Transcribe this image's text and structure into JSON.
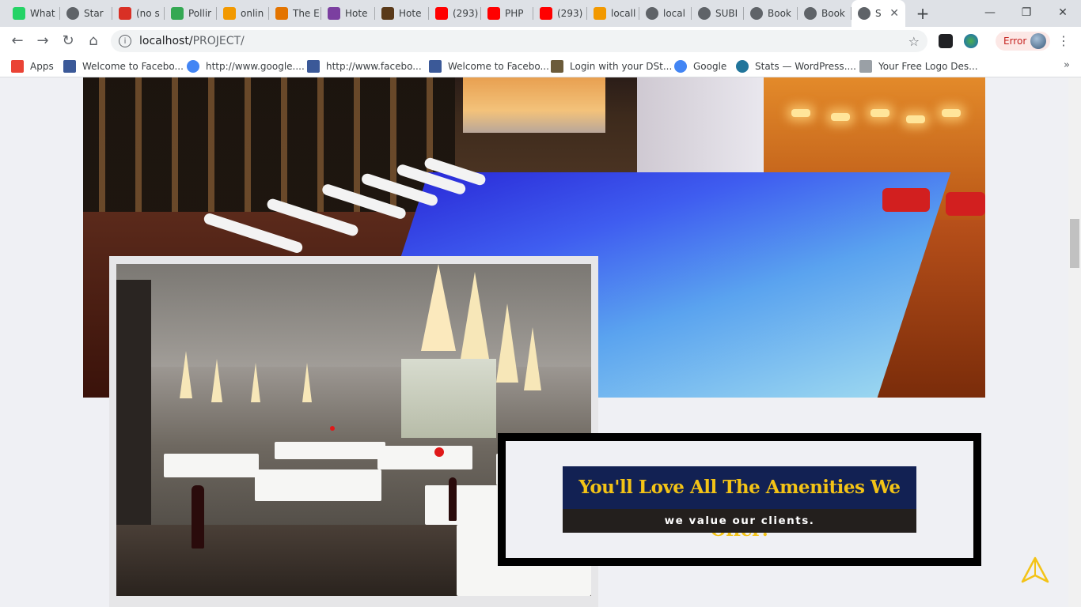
{
  "browser": {
    "tabs": [
      {
        "label": "What",
        "icon": "whatsapp-icon",
        "color": "#25d366"
      },
      {
        "label": "Star",
        "icon": "globe-icon",
        "color": "#5f6368"
      },
      {
        "label": "(no s",
        "icon": "gmail-icon",
        "color": "#d93025"
      },
      {
        "label": "Pollir",
        "icon": "download-arrow-icon",
        "color": "#34a853"
      },
      {
        "label": "onlin",
        "icon": "diamond-icon",
        "color": "#f29900"
      },
      {
        "label": "The E",
        "icon": "pen-icon",
        "color": "#e37400"
      },
      {
        "label": "Hote",
        "icon": "grid-logo-icon",
        "color": "#7b3fa0"
      },
      {
        "label": "Hote",
        "icon": "hotel-logo-icon",
        "color": "#5a3a1a"
      },
      {
        "label": "(293)",
        "icon": "youtube-icon",
        "color": "#ff0000"
      },
      {
        "label": "PHP",
        "icon": "youtube-icon",
        "color": "#ff0000"
      },
      {
        "label": "(293)",
        "icon": "youtube-icon",
        "color": "#ff0000"
      },
      {
        "label": "locall",
        "icon": "phpmyadmin-icon",
        "color": "#f29900"
      },
      {
        "label": "local",
        "icon": "globe-icon",
        "color": "#5f6368"
      },
      {
        "label": "SUBI",
        "icon": "globe-icon",
        "color": "#5f6368"
      },
      {
        "label": "Book",
        "icon": "globe-icon",
        "color": "#5f6368"
      },
      {
        "label": "Book",
        "icon": "globe-icon",
        "color": "#5f6368"
      },
      {
        "label": "S",
        "icon": "globe-icon",
        "color": "#5f6368",
        "active": true
      }
    ],
    "url_host": "localhost/",
    "url_path": "PROJECT/",
    "error_label": "Error"
  },
  "bookmarks": [
    {
      "label": "Apps",
      "icon": "apps-grid-icon",
      "color": "#ea4335"
    },
    {
      "label": "Welcome to Facebo...",
      "icon": "facebook-icon",
      "color": "#3b5998"
    },
    {
      "label": "http://www.google....",
      "icon": "google-icon",
      "color": "#4285f4"
    },
    {
      "label": "http://www.facebo...",
      "icon": "facebook-icon",
      "color": "#3b5998"
    },
    {
      "label": "Welcome to Facebo...",
      "icon": "facebook-icon",
      "color": "#3b5998"
    },
    {
      "label": "Login with your DSt...",
      "icon": "eye-icon",
      "color": "#6b5b3a"
    },
    {
      "label": "Google",
      "icon": "google-icon",
      "color": "#4285f4"
    },
    {
      "label": "Stats — WordPress....",
      "icon": "wordpress-icon",
      "color": "#21759b"
    },
    {
      "label": "Your Free Logo Des...",
      "icon": "dots-grid-icon",
      "color": "#9aa0a6"
    }
  ],
  "promo": {
    "headline": "You'll Love All The Amenities We Offer!",
    "subline": "we value our clients.",
    "headline_bg": "#122153",
    "headline_color": "#f3c316",
    "subline_bg": "#231f1d"
  },
  "scroll_top_color": "#f3c316"
}
